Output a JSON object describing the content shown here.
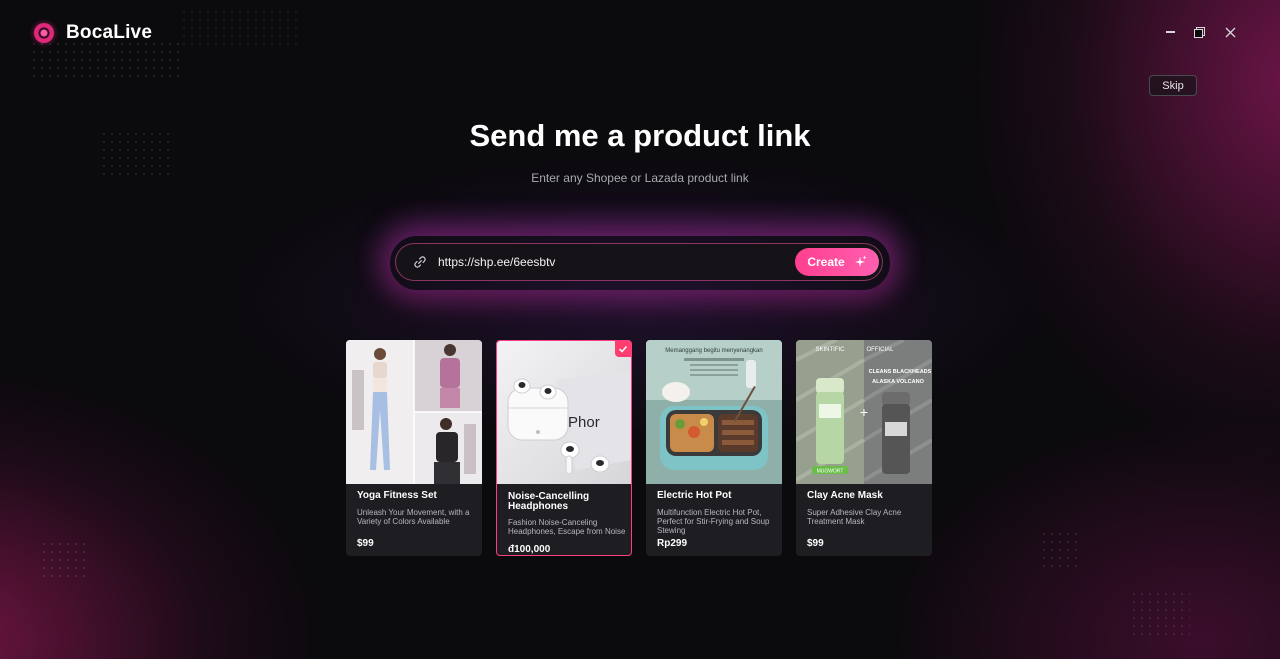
{
  "app": {
    "name": "BocaLive",
    "accent": "#ff3f8f"
  },
  "window_controls": {
    "minimize_icon": "minimize-icon",
    "restore_icon": "restore-icon",
    "close_icon": "close-icon"
  },
  "skip_label": "Skip",
  "heading": "Send me a product link",
  "subheading": "Enter any Shopee or Lazada product link",
  "link_input": {
    "value": "https://shp.ee/6eesbtv",
    "icon": "link-icon"
  },
  "create_button": {
    "label": "Create",
    "icon": "sparkle-icon"
  },
  "products": [
    {
      "title": "Yoga Fitness Set",
      "description": "Unleash Your Movement, with a Variety of Colors Available",
      "price": "$99",
      "selected": false
    },
    {
      "title": "Noise-Cancelling Headphones",
      "description": "Fashion Noise-Canceling Headphones, Escape from Noise",
      "price": "đ100,000",
      "selected": true,
      "image_text": "Phor"
    },
    {
      "title": "Electric Hot Pot",
      "description": "Multifunction Electric Hot Pot, Perfect for Stir-Frying and Soup Stewing",
      "price": "Rp299",
      "selected": false,
      "image_text": "Memanggang begitu menyenangkan"
    },
    {
      "title": "Clay Acne Mask",
      "description": "Super Adhesive Clay Acne Treatment Mask",
      "price": "$99",
      "selected": false,
      "image_text": [
        "SKINTIFIC",
        "OFFICIAL",
        "CLEANS BLACKHEADS",
        "ALASKA VOLCANO",
        "MUGWORT"
      ]
    }
  ]
}
